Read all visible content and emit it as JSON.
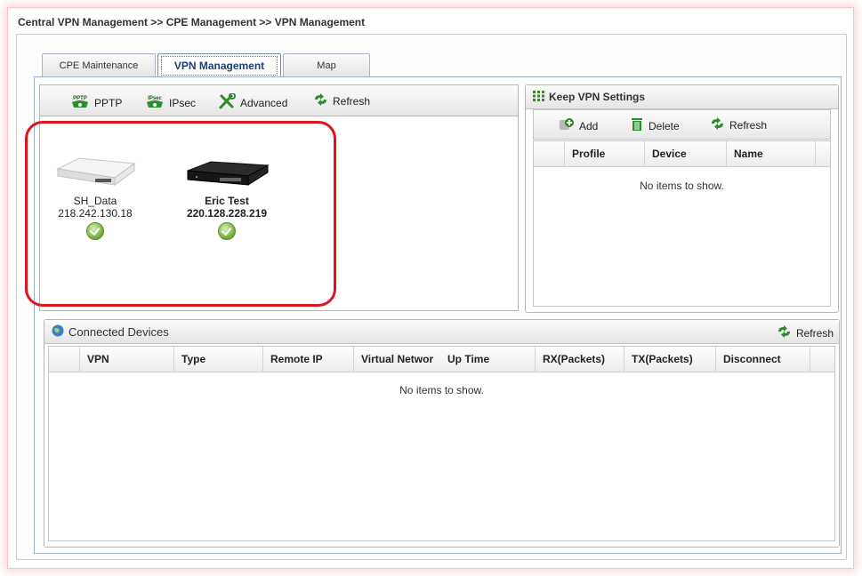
{
  "breadcrumb": "Central VPN Management >> CPE Management >> VPN Management",
  "tabs": [
    {
      "label": "CPE Maintenance"
    },
    {
      "label": "VPN Management"
    },
    {
      "label": "Map"
    }
  ],
  "toolbar": {
    "pptp": "PPTP",
    "ipsec": "IPsec",
    "advanced": "Advanced",
    "refresh": "Refresh",
    "pptp_icon_text": "PPTP",
    "ipsec_icon_text": "IPsec"
  },
  "devices": [
    {
      "name": "SH_Data",
      "ip": "218.242.130.18",
      "status": "ok"
    },
    {
      "name": "Eric  Test",
      "ip": "220.128.228.219",
      "status": "ok"
    }
  ],
  "keep_vpn": {
    "title": "Keep VPN Settings",
    "add": "Add",
    "delete": "Delete",
    "refresh": "Refresh",
    "columns": [
      "Profile",
      "Device",
      "Name"
    ],
    "empty": "No items to show."
  },
  "connected": {
    "title": "Connected Devices",
    "refresh": "Refresh",
    "columns": [
      "VPN",
      "Type",
      "Remote IP",
      "Virtual Networ",
      "Up Time",
      "RX(Packets)",
      "TX(Packets)",
      "Disconnect"
    ],
    "empty": "No items to show."
  },
  "colors": {
    "accent": "#1d3f73",
    "highlight": "#e0151b",
    "ok": "#6faa33",
    "refresh": "#2e8b2e"
  }
}
